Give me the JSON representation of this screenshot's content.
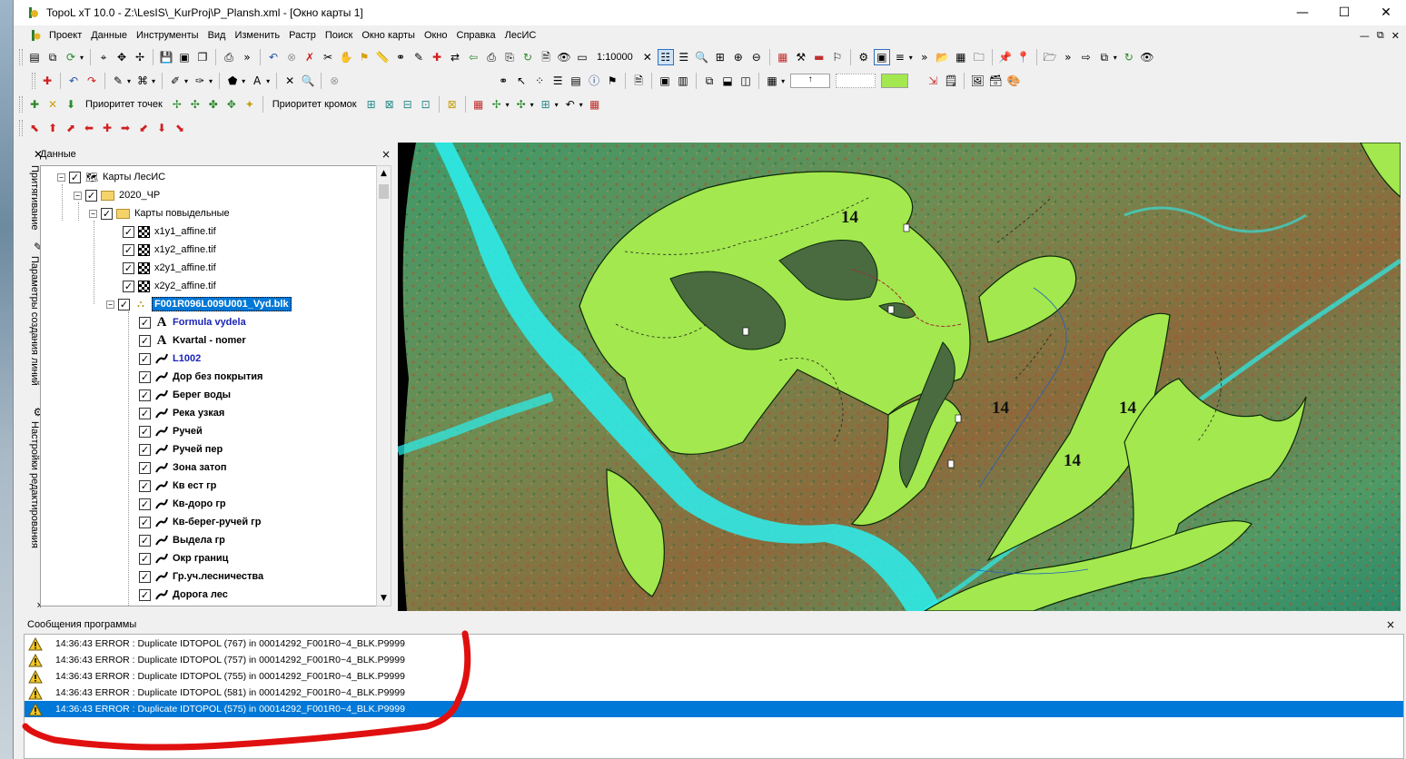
{
  "window": {
    "title": "TopoL xT 10.0 - Z:\\LesIS\\_KurProj\\P_Plansh.xml - [Окно карты 1]",
    "min_glyph": "—",
    "max_glyph": "☐",
    "close_glyph": "✕"
  },
  "menu": {
    "items": [
      "Проект",
      "Данные",
      "Инструменты",
      "Вид",
      "Изменить",
      "Растр",
      "Поиск",
      "Окно карты",
      "Окно",
      "Справка",
      "ЛесИС"
    ],
    "right": [
      "—",
      "⧉",
      "✕"
    ]
  },
  "toolbar": {
    "scale": "1:10000",
    "point_priority": "Приоритет точек",
    "edge_priority": "Приоритет кромок"
  },
  "side_tabs": [
    "Притягивание",
    "Параметры создания линий",
    "Настройки редактирования"
  ],
  "data_panel": {
    "title": "Данные",
    "close": "×",
    "tree": {
      "root": "Карты ЛесИС",
      "folder": "2020_ЧР",
      "subfolder": "Карты повыдельные",
      "rasters": [
        "x1y1_affine.tif",
        "x1y2_affine.tif",
        "x2y1_affine.tif",
        "x2y2_affine.tif"
      ],
      "block": "F001R096L009U001_Vyd.blk",
      "layers": [
        {
          "label": "Formula vydela",
          "icon": "A",
          "color": "#1a24b8"
        },
        {
          "label": "Kvartal - nomer",
          "icon": "A",
          "color": "#000000"
        },
        {
          "label": "L1002",
          "icon": "line",
          "color": "#1a24b8"
        },
        {
          "label": "Дор без покрытия",
          "icon": "line",
          "color": "#000000"
        },
        {
          "label": "Берег воды",
          "icon": "line",
          "color": "#000000"
        },
        {
          "label": "Река узкая",
          "icon": "line",
          "color": "#000000"
        },
        {
          "label": "Ручей",
          "icon": "line",
          "color": "#000000"
        },
        {
          "label": "Ручей пер",
          "icon": "line",
          "color": "#000000"
        },
        {
          "label": "Зона затоп",
          "icon": "line",
          "color": "#000000"
        },
        {
          "label": "Кв ест гр",
          "icon": "line",
          "color": "#000000"
        },
        {
          "label": "Кв-доро гр",
          "icon": "line",
          "color": "#000000"
        },
        {
          "label": "Кв-берег-ручей гр",
          "icon": "line",
          "color": "#000000"
        },
        {
          "label": "Выдела гр",
          "icon": "line",
          "color": "#000000"
        },
        {
          "label": "Окр границ",
          "icon": "line",
          "color": "#000000"
        },
        {
          "label": "Гр.уч.лесничества",
          "icon": "line",
          "color": "#000000"
        },
        {
          "label": "Дорога лес",
          "icon": "line",
          "color": "#000000"
        }
      ]
    }
  },
  "map": {
    "labels": [
      "14",
      "14",
      "14",
      "14"
    ],
    "fill_color": "#a3e84e",
    "water_color": "#2af0f0"
  },
  "messages": {
    "title": "Сообщения программы",
    "close": "×",
    "rows": [
      "14:36:43 ERROR : Duplicate IDTOPOL (767) in 00014292_F001R0~4_BLK.P9999",
      "14:36:43 ERROR : Duplicate IDTOPOL (757) in 00014292_F001R0~4_BLK.P9999",
      "14:36:43 ERROR : Duplicate IDTOPOL (755) in 00014292_F001R0~4_BLK.P9999",
      "14:36:43 ERROR : Duplicate IDTOPOL (581) in 00014292_F001R0~4_BLK.P9999",
      "14:36:43 ERROR : Duplicate IDTOPOL (575) in 00014292_F001R0~4_BLK.P9999"
    ],
    "selected_index": 4
  },
  "colors": {
    "selection": "#0078d7",
    "annotation_red": "#e01010"
  }
}
